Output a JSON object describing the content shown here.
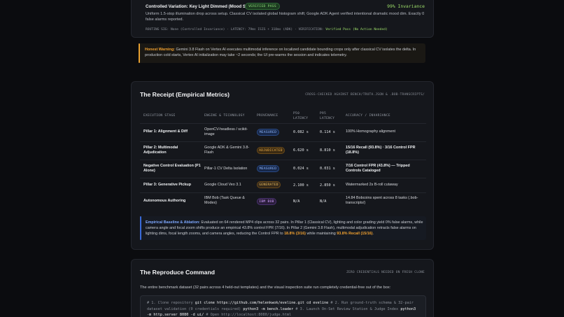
{
  "card1": {
    "title": "Controlled Variation: Key Light Dimmed (Mood Shift)",
    "pill": "VERIFIED PASS",
    "pct": "99% Invariance",
    "desc": "Uniform 1.5-stop illumination drop across setup. Classical CV isolated global histogram shift; Google ADK Agent verified intentional dramatic mood dim. Exactly 0 false alarms reported.",
    "status_prefix": "ROUTING SIG: None (Controlled Invariance) · LATENCY: 79ms ISIS + 318ms (ADK) · VERIFICATION:",
    "status_result": "Verified Pass (No Action Needed)"
  },
  "warning": {
    "label": "Honest Warning:",
    "text": "Gemini 3.8 Flash on Vertex AI executes multimodal inference on localized candidate bounding crops only after classical CV isolates the delta. In production cold starts, Vertex AI initialization may take ~2 seconds; the UI pre-warms the session and indicates telemetry."
  },
  "receipt": {
    "title": "The Receipt (Empirical Metrics)",
    "subtitle": "CROSS-CHECKED AGAINST BENCH/TRUTH.JSON & .BOB-TRANSCRIPTS/",
    "headers": {
      "stage": "EXECUTION STAGE",
      "engine": "ENGINE & TECHNOLOGY",
      "provenance": "PROVENANCE",
      "p50": "P50 LATENCY",
      "p95": "P95 LATENCY",
      "accuracy": "ACCURACY / INVARIANCE"
    },
    "rows": [
      {
        "stage": "Pillar 1: Alignment & Diff",
        "engine": "OpenCV-headless / scikit-image",
        "prov": "MEASURED",
        "p50": "0.082 s",
        "p95": "0.114 s",
        "acc": "100% Homography alignment"
      },
      {
        "stage": "Pillar 2: Multimodal Adjudication",
        "engine": "Google ADK & Gemini 3.8-Flash",
        "prov": "ADJUDICATED",
        "p50": "6.620 s",
        "p95": "8.810 s",
        "acc": "15/16 Recall (93.8%) · 3/16 Control FPR (18.8%)"
      },
      {
        "stage": "Negative Control Evaluation (P1 Alone)",
        "engine": "Pillar-1 CV Delta Isolation",
        "prov": "MEASURED",
        "p50": "0.024 s",
        "p95": "0.031 s",
        "acc": "7/16 Control FPR (43.8%) — Tripped Controls Cataloged"
      },
      {
        "stage": "Pillar 3: Generative Pickup",
        "engine": "Google Cloud Veo 3.1",
        "prov": "GENERATED",
        "p50": "2.100 s",
        "p95": "2.850 s",
        "acc": "Watermarked 2s B-roll cutaway"
      },
      {
        "stage": "Autonomous Authoring",
        "engine": "IBM Bob (Task Queue & Modes)",
        "prov": "IBM BOB",
        "p50": "N/A",
        "p95": "N/A",
        "acc": "14.84 Bobcoins spent across 8 tasks (.bob-transcripts/)"
      }
    ],
    "baseline_label": "Empirical Baseline & Ablation:",
    "baseline_text": "Evaluated on 64 rendered MP4 clips across 32 pairs. In Pillar 1 (Classical CV), lighting and color grading yield 0% false alarms, while camera angle and focal zoom shifts produce an empirical 43.8% control FPR (7/16). In Pillar 2 (Gemini 3.8 Flash), multimodal adjudication retracts false alarms on lighting dims, focal length zooms, and camera angles, reducing the Control FPR to",
    "baseline_fpr": "18.8% (3/16)",
    "baseline_mid": "while maintaining",
    "baseline_recall": "93.8% Recall (15/16)",
    "baseline_end": "."
  },
  "reproduce": {
    "title": "The Reproduce Command",
    "subtitle": "ZERO CREDENTIALS NEEDED ON FRESH CLONE",
    "desc": "The entire benchmark dataset (32 pairs across 4 held-out templates) and the visual inspection suite run completely credential-free out of the box:",
    "code": [
      {
        "c": "# 1. Clone repository",
        "cmd": "git clone https://github.com/helenkwok/eveline.git cd eveline"
      },
      {
        "c": "# 2. Run ground-truth schema & 32-pair dataset validation (0 credentials required)",
        "cmd": "python3 -m bench.loader"
      },
      {
        "c": "# 3. Launch On-Set Review Station & Judge Index",
        "cmd": "python3 -m http.server 8080 -d ui/"
      },
      {
        "c": "# Open http://localhost:8080/judge.html",
        "cmd": ""
      }
    ]
  }
}
